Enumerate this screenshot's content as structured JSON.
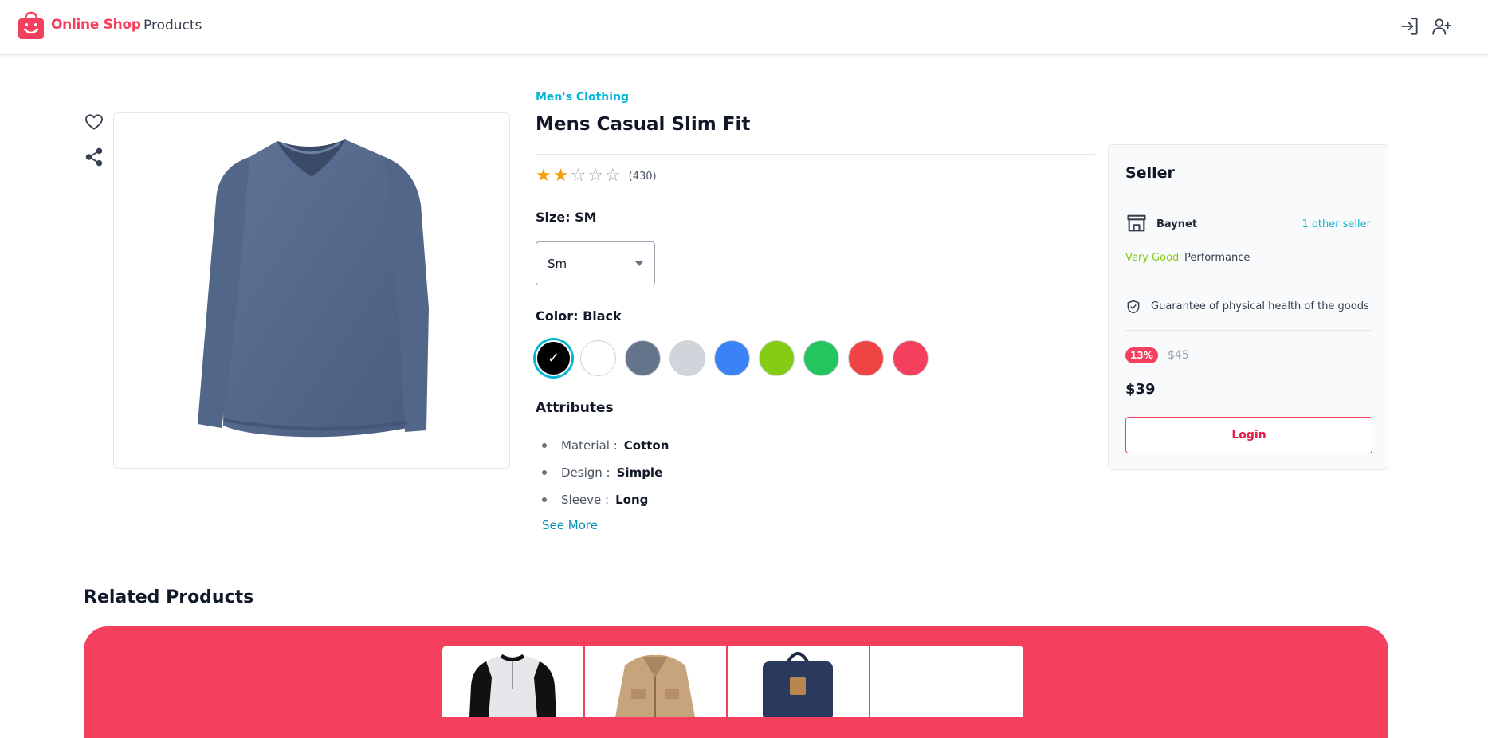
{
  "header": {
    "brand": "Online Shop",
    "nav_products": "Products",
    "brand_color": "#f43f5e",
    "icons": [
      "login-icon",
      "user-plus-icon"
    ]
  },
  "gallery": {
    "icons": [
      "heart-icon",
      "share-icon"
    ],
    "main_image": "blue long-sleeve v-neck t-shirt"
  },
  "product": {
    "category": "Men's Clothing",
    "title": "Mens Casual Slim Fit",
    "rating": 2,
    "rating_max": 5,
    "review_count": "(430)",
    "size_label": "Size: SM",
    "size_selected": "Sm",
    "color_label": "Color: Black",
    "colors": [
      "#000000",
      "#ffffff",
      "#64748b",
      "#d1d5db",
      "#3b82f6",
      "#84cc16",
      "#22c55e",
      "#ef4444",
      "#f43f5e"
    ],
    "selected_color_index": 0,
    "attributes_title": "Attributes",
    "attributes": [
      {
        "name": "Material :",
        "value": "Cotton"
      },
      {
        "name": "Design :",
        "value": "Simple"
      },
      {
        "name": "Sleeve :",
        "value": "Long"
      }
    ],
    "see_more": "See More"
  },
  "seller": {
    "title": "Seller",
    "name": "Baynet",
    "other_sellers": "1 other seller",
    "performance_rating": "Very Good",
    "performance_label": "Performance",
    "guarantee": "Guarantee of physical health of the goods",
    "discount": "13%",
    "old_price": "$45",
    "price": "$39",
    "login_button": "Login"
  },
  "related": {
    "title": "Related Products",
    "band_color": "#f43f5e",
    "items": [
      "henley shirt",
      "beige jacket",
      "navy backpack",
      ""
    ]
  }
}
